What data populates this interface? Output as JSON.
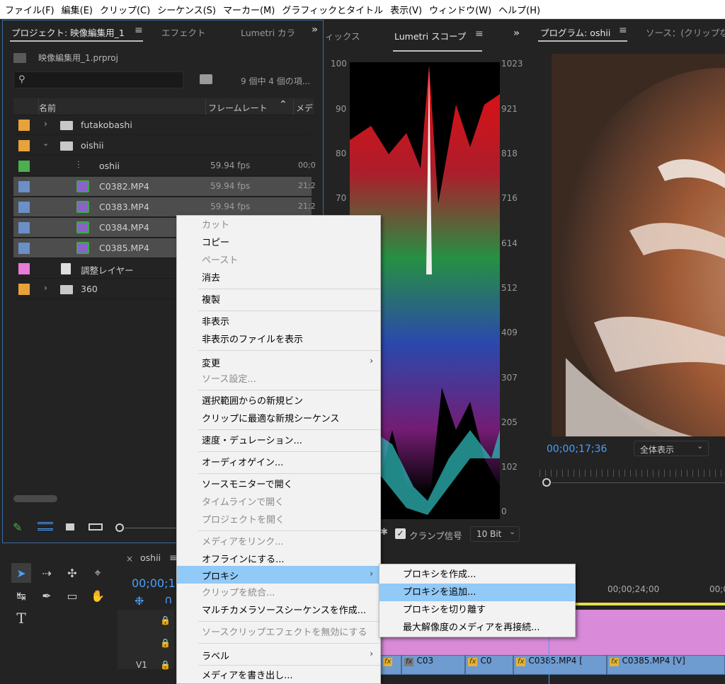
{
  "menubar": [
    "ファイル(F)",
    "編集(E)",
    "クリップ(C)",
    "シーケンス(S)",
    "マーカー(M)",
    "グラフィックとタイトル",
    "表示(V)",
    "ウィンドウ(W)",
    "ヘルプ(H)"
  ],
  "project": {
    "tab_label": "プロジェクト: 映像編集用_1",
    "tab_effects": "エフェクト",
    "tab_lumetri": "Lumetri カラ",
    "file": "映像編集用_1.prproj",
    "count": "9 個中 4 個の項...",
    "col_name": "名前",
    "col_framerate": "フレームレート",
    "col_media": "メデ",
    "items": [
      {
        "name": "futakobashi",
        "fps": "",
        "media": "",
        "color": "#e8a23a",
        "type": "bin"
      },
      {
        "name": "oishii",
        "fps": "",
        "media": "",
        "color": "#e8a23a",
        "type": "bin-open"
      },
      {
        "name": "oshii",
        "fps": "59.94 fps",
        "media": "00;0",
        "color": "#4caf50",
        "type": "sequence"
      },
      {
        "name": "C0382.MP4",
        "fps": "59.94 fps",
        "media": "21;2",
        "color": "#6b8fc7",
        "type": "clip"
      },
      {
        "name": "C0383.MP4",
        "fps": "59.94 fps",
        "media": "21;2",
        "color": "#6b8fc7",
        "type": "clip"
      },
      {
        "name": "C0384.MP4",
        "fps": "",
        "media": "",
        "color": "#6b8fc7",
        "type": "clip"
      },
      {
        "name": "C0385.MP4",
        "fps": "",
        "media": "",
        "color": "#6b8fc7",
        "type": "clip"
      },
      {
        "name": "調整レイヤー",
        "fps": "",
        "media": "",
        "color": "#e87ad8",
        "type": "adjust"
      },
      {
        "name": "360",
        "fps": "",
        "media": "",
        "color": "#e8a23a",
        "type": "bin"
      }
    ]
  },
  "scopes": {
    "tab_prev": "ィックス",
    "tab_active": "Lumetri スコープ",
    "left_scale": [
      "100",
      "90",
      "80",
      "70"
    ],
    "right_scale": [
      "1023",
      "921",
      "818",
      "716",
      "614",
      "512",
      "409",
      "307",
      "205",
      "102",
      "0"
    ],
    "clamp_label": "クランプ信号",
    "bit_label": "10 Bit"
  },
  "program": {
    "tab_label": "プログラム: oshii",
    "tab_source": "ソース：(クリップな",
    "timecode": "00;00;17;36",
    "zoom": "全体表示"
  },
  "timeline": {
    "seq_tab": "oshii",
    "timecode": "00;00;1",
    "ruler_time": "00;00;24;00",
    "ruler_time2": "00;0",
    "track_v1": "V1",
    "clips": [
      "C03",
      "C0",
      "C0385.MP4 [",
      "C0385.MP4 [V]"
    ]
  },
  "context_menu": {
    "items": [
      {
        "label": "カット",
        "disabled": true
      },
      {
        "label": "コピー",
        "disabled": false
      },
      {
        "label": "ペースト",
        "disabled": true
      },
      {
        "label": "消去",
        "disabled": false
      },
      {
        "label": "複製",
        "disabled": false
      },
      {
        "label": "非表示",
        "disabled": false
      },
      {
        "label": "非表示のファイルを表示",
        "disabled": false
      },
      {
        "label": "変更",
        "disabled": false,
        "submenu": true
      },
      {
        "label": "ソース設定...",
        "disabled": true
      },
      {
        "label": "選択範囲からの新規ビン",
        "disabled": false
      },
      {
        "label": "クリップに最適な新規シーケンス",
        "disabled": false
      },
      {
        "label": "速度・デュレーション...",
        "disabled": false
      },
      {
        "label": "オーディオゲイン...",
        "disabled": false
      },
      {
        "label": "ソースモニターで開く",
        "disabled": false
      },
      {
        "label": "タイムラインで開く",
        "disabled": true
      },
      {
        "label": "プロジェクトを開く",
        "disabled": true
      },
      {
        "label": "メディアをリンク...",
        "disabled": true
      },
      {
        "label": "オフラインにする...",
        "disabled": false
      },
      {
        "label": "プロキシ",
        "disabled": false,
        "submenu": true,
        "highlighted": true
      },
      {
        "label": "クリップを統合...",
        "disabled": true
      },
      {
        "label": "マルチカメラソースシーケンスを作成...",
        "disabled": false
      },
      {
        "label": "ソースクリップエフェクトを無効にする",
        "disabled": true
      },
      {
        "label": "ラベル",
        "disabled": false,
        "submenu": true
      },
      {
        "label": "メディアを書き出し...",
        "disabled": false
      }
    ],
    "submenu": [
      {
        "label": "プロキシを作成...",
        "highlighted": false
      },
      {
        "label": "プロキシを追加...",
        "highlighted": true
      },
      {
        "label": "プロキシを切り離す",
        "highlighted": false
      },
      {
        "label": "最大解像度のメディアを再接続...",
        "highlighted": false
      }
    ]
  },
  "colors": {
    "accent": "#4a9fff",
    "highlight": "#91c9f7"
  }
}
